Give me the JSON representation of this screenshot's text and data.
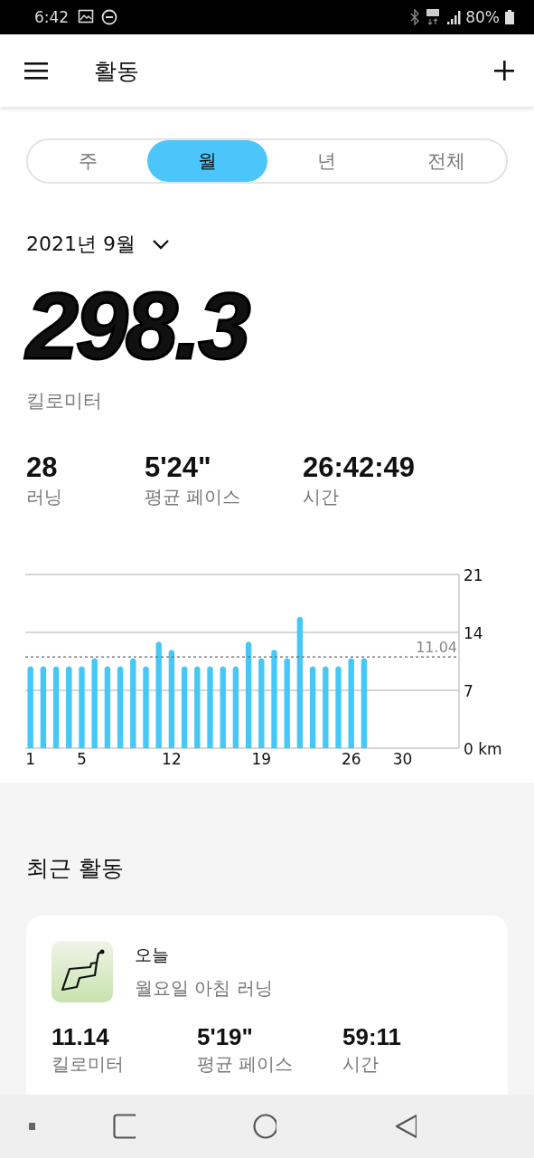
{
  "status_bar": {
    "time": "6:42",
    "battery": "80%"
  },
  "app_bar": {
    "title": "활동"
  },
  "period_tabs": [
    {
      "label": "주",
      "selected": false
    },
    {
      "label": "월",
      "selected": true
    },
    {
      "label": "년",
      "selected": false
    },
    {
      "label": "전체",
      "selected": false
    }
  ],
  "period": {
    "label": "2021년 9월"
  },
  "total": {
    "value": "298.3",
    "unit": "킬로미터"
  },
  "stats": [
    {
      "value": "28",
      "label": "러닝"
    },
    {
      "value": "5'24\"",
      "label": "평균 페이스"
    },
    {
      "value": "26:42:49",
      "label": "시간"
    }
  ],
  "chart_data": {
    "type": "bar",
    "x": [
      1,
      2,
      3,
      4,
      5,
      6,
      7,
      8,
      9,
      10,
      11,
      12,
      13,
      14,
      15,
      16,
      17,
      18,
      19,
      20,
      21,
      22,
      23,
      24,
      25,
      26,
      27
    ],
    "values": [
      10,
      10,
      10,
      10,
      10,
      11,
      10,
      10,
      11,
      10,
      13,
      12,
      10,
      10,
      10,
      10,
      10,
      13,
      11,
      12,
      11,
      16,
      10,
      10,
      10,
      11,
      11
    ],
    "xlim": [
      0.6,
      34.4
    ],
    "ylim": [
      0,
      21
    ],
    "yticks": [
      {
        "value": 0,
        "label": "0 km"
      },
      7,
      14,
      21
    ],
    "xticks": [
      1,
      5,
      12,
      19,
      26,
      30
    ],
    "ref_lines": [
      {
        "axis": "y",
        "value": 11.04,
        "label": "11.04"
      }
    ]
  },
  "recent": {
    "title": "최근 활동",
    "activities": [
      {
        "date": "오늘",
        "name": "월요일 아침 러닝",
        "stats": [
          {
            "value": "11.14",
            "label": "킬로미터"
          },
          {
            "value": "5'19\"",
            "label": "평균 페이스"
          },
          {
            "value": "59:11",
            "label": "시간"
          }
        ]
      }
    ]
  }
}
